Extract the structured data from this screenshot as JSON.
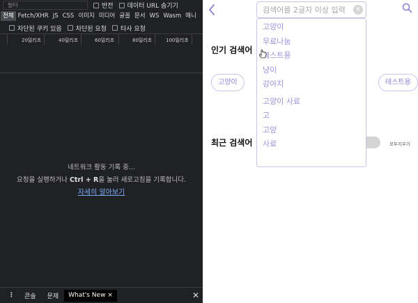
{
  "devtools": {
    "filter_placeholder": "필터",
    "invert_label": "반전",
    "hide_data_url_label": "데이터 URL 숨기기",
    "filter_types": [
      "전체",
      "Fetch/XHR",
      "JS",
      "CSS",
      "이미지",
      "미디어",
      "글꼴",
      "문서",
      "WS",
      "Wasm",
      "매니"
    ],
    "active_filter": "전체",
    "blocked_cookies_label": "차단된 쿠키 있음",
    "blocked_requests_label": "차단된 요청",
    "third_party_label": "타사 요청",
    "timeline_ticks": [
      "20밀리초",
      "40밀리초",
      "60밀리초",
      "80밀리초",
      "100밀리초"
    ],
    "empty": {
      "line1": "네트워크 활동 기록 중...",
      "line2_before": "요청을 실행하거나 ",
      "line2_shortcut": "Ctrl + R",
      "line2_after": "을 눌러 새로고침을 기록합니다.",
      "learn_more": "자세히 알아보기"
    },
    "drawer": {
      "console": "콘솔",
      "issues": "문제",
      "whats_new": "What's New"
    }
  },
  "page": {
    "search_placeholder": "검색어를 2글자 이상 입력",
    "popular_title": "인기 검색어",
    "recent_title": "최근 검색어",
    "clear_all_label": "모두지우기",
    "popular_tags": [
      "고양이",
      "테스트용"
    ],
    "autocomplete": {
      "group1": [
        "고양이",
        "무료나눔",
        "테스트용",
        "냥이",
        "강아지"
      ],
      "group2": [
        "고양이 사료",
        "고",
        "고양",
        "사료"
      ]
    },
    "accent_color": "#8b80d6"
  }
}
